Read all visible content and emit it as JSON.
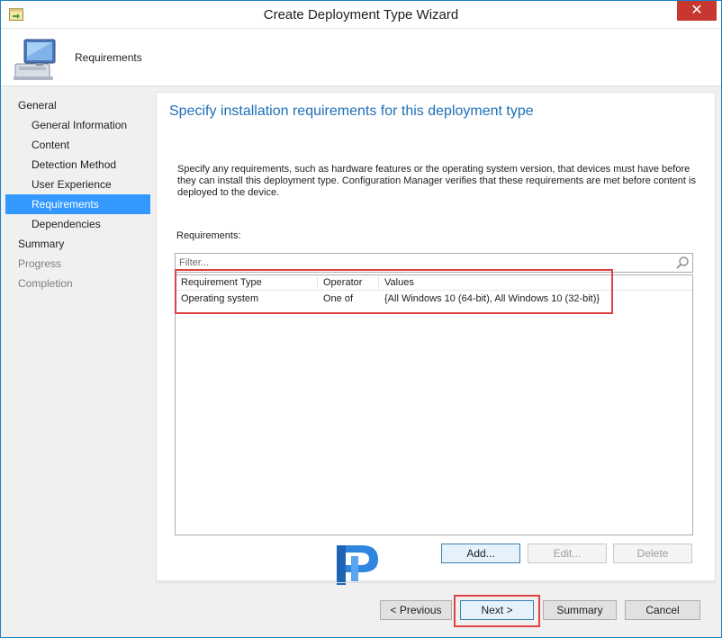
{
  "window": {
    "title": "Create Deployment Type Wizard",
    "close_glyph": "✕"
  },
  "header": {
    "page_label": "Requirements",
    "icon": "computer-icon"
  },
  "sidebar": {
    "items": [
      {
        "label": "General",
        "level": "top",
        "state": "normal"
      },
      {
        "label": "General Information",
        "level": "sub",
        "state": "normal"
      },
      {
        "label": "Content",
        "level": "sub",
        "state": "normal"
      },
      {
        "label": "Detection Method",
        "level": "sub",
        "state": "normal"
      },
      {
        "label": "User Experience",
        "level": "sub",
        "state": "normal"
      },
      {
        "label": "Requirements",
        "level": "sub",
        "state": "selected"
      },
      {
        "label": "Dependencies",
        "level": "sub",
        "state": "normal"
      },
      {
        "label": "Summary",
        "level": "top",
        "state": "normal"
      },
      {
        "label": "Progress",
        "level": "top",
        "state": "disabled"
      },
      {
        "label": "Completion",
        "level": "top",
        "state": "disabled"
      }
    ]
  },
  "main": {
    "heading": "Specify installation requirements for this deployment type",
    "description": "Specify any requirements, such as hardware features or the operating system version, that devices must have before they can install this deployment type. Configuration Manager verifies that these requirements are met before content is deployed to the device.",
    "requirements_label": "Requirements:",
    "filter_placeholder": "Filter...",
    "table": {
      "columns": [
        "Requirement Type",
        "Operator",
        "Values"
      ],
      "rows": [
        [
          "Operating system",
          "One of",
          "{All Windows 10 (64-bit), All Windows 10 (32-bit)}"
        ]
      ]
    },
    "buttons": {
      "add": "Add...",
      "edit": "Edit...",
      "delete": "Delete"
    }
  },
  "footer": {
    "previous": "< Previous",
    "next": "Next >",
    "summary": "Summary",
    "cancel": "Cancel"
  },
  "colors": {
    "accent": "#3399ff",
    "heading": "#1e6fb8",
    "highlight": "#e04343",
    "close": "#c7372f"
  }
}
